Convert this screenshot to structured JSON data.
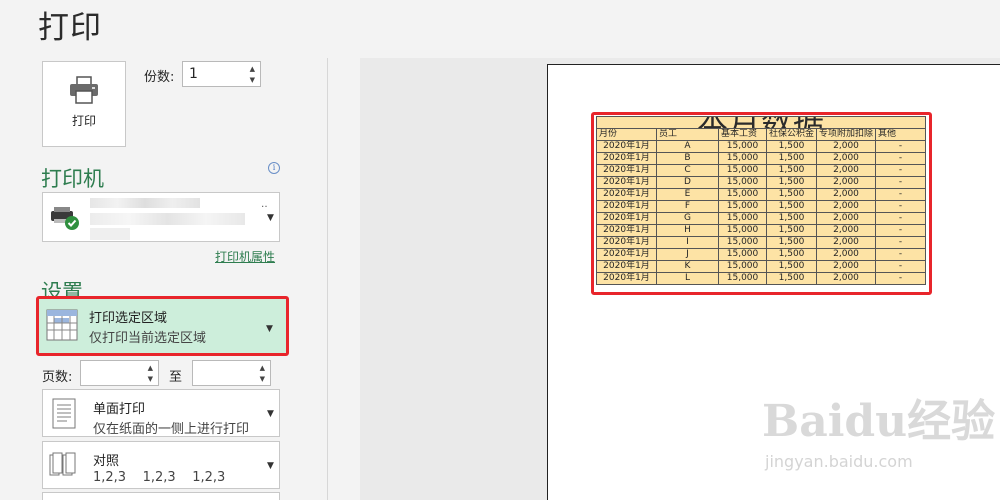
{
  "title": "打印",
  "print_button": {
    "label": "打印",
    "icon": "printer-icon"
  },
  "copies": {
    "label": "份数:",
    "value": "1"
  },
  "printer": {
    "heading": "打印机",
    "properties_link": "打印机属性",
    "status_icon": "check-circle-icon"
  },
  "settings": {
    "heading": "设置",
    "print_area": {
      "title": "打印选定区域",
      "subtitle": "仅打印当前选定区域"
    },
    "pages": {
      "label": "页数:",
      "to_label": "至",
      "from": "",
      "to": ""
    },
    "sides": {
      "title": "单面打印",
      "subtitle": "仅在纸面的一侧上进行打印"
    },
    "collate": {
      "title": "对照",
      "subtitle": "1,2,3    1,2,3    1,2,3"
    }
  },
  "preview": {
    "table_title": "本月数据",
    "headers": [
      "月份",
      "员工",
      "基本工资",
      "社保公积金",
      "专项附加扣除",
      "其他"
    ],
    "rows": [
      [
        "2020年1月",
        "A",
        "15,000",
        "1,500",
        "2,000",
        "-"
      ],
      [
        "2020年1月",
        "B",
        "15,000",
        "1,500",
        "2,000",
        "-"
      ],
      [
        "2020年1月",
        "C",
        "15,000",
        "1,500",
        "2,000",
        "-"
      ],
      [
        "2020年1月",
        "D",
        "15,000",
        "1,500",
        "2,000",
        "-"
      ],
      [
        "2020年1月",
        "E",
        "15,000",
        "1,500",
        "2,000",
        "-"
      ],
      [
        "2020年1月",
        "F",
        "15,000",
        "1,500",
        "2,000",
        "-"
      ],
      [
        "2020年1月",
        "G",
        "15,000",
        "1,500",
        "2,000",
        "-"
      ],
      [
        "2020年1月",
        "H",
        "15,000",
        "1,500",
        "2,000",
        "-"
      ],
      [
        "2020年1月",
        "I",
        "15,000",
        "1,500",
        "2,000",
        "-"
      ],
      [
        "2020年1月",
        "J",
        "15,000",
        "1,500",
        "2,000",
        "-"
      ],
      [
        "2020年1月",
        "K",
        "15,000",
        "1,500",
        "2,000",
        "-"
      ],
      [
        "2020年1月",
        "L",
        "15,000",
        "1,500",
        "2,000",
        "-"
      ]
    ]
  },
  "watermark": {
    "brand": "Baidu经验",
    "url": "jingyan.baidu.com"
  },
  "colors": {
    "accent": "#2e7d4f",
    "highlight": "#e8252b",
    "selected": "#cdeedb",
    "cell": "#fde3a5"
  }
}
